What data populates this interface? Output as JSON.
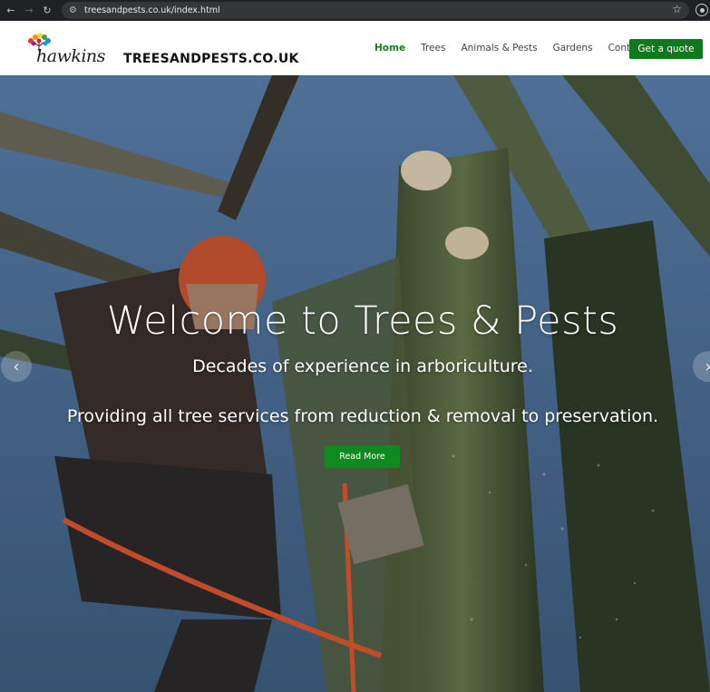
{
  "browser": {
    "url": "treesandpests.co.uk/index.html",
    "icons": [
      "back-icon",
      "forward-icon",
      "reload-icon",
      "site-settings-icon",
      "bookmark-star-icon",
      "profile-icon"
    ]
  },
  "header": {
    "logo_text": "hawkins",
    "site_title": "TREESANDPESTS.CO.UK",
    "nav": [
      {
        "label": "Home",
        "active": true
      },
      {
        "label": "Trees",
        "active": false
      },
      {
        "label": "Animals & Pests",
        "active": false
      },
      {
        "label": "Gardens",
        "active": false
      },
      {
        "label": "Contact",
        "active": false
      }
    ],
    "cta_label": "Get a quote"
  },
  "hero": {
    "title": "Welcome to Trees & Pests",
    "subtitle_1": "Decades of experience in arboriculture.",
    "subtitle_2": "Providing all tree services from reduction & removal to preservation.",
    "button_label": "Read More",
    "prev_arrow": "‹",
    "next_arrow": "›"
  },
  "colors": {
    "brand_green": "#0e7a1c",
    "nav_active": "#1a7a26",
    "chrome_bg": "#202124"
  }
}
